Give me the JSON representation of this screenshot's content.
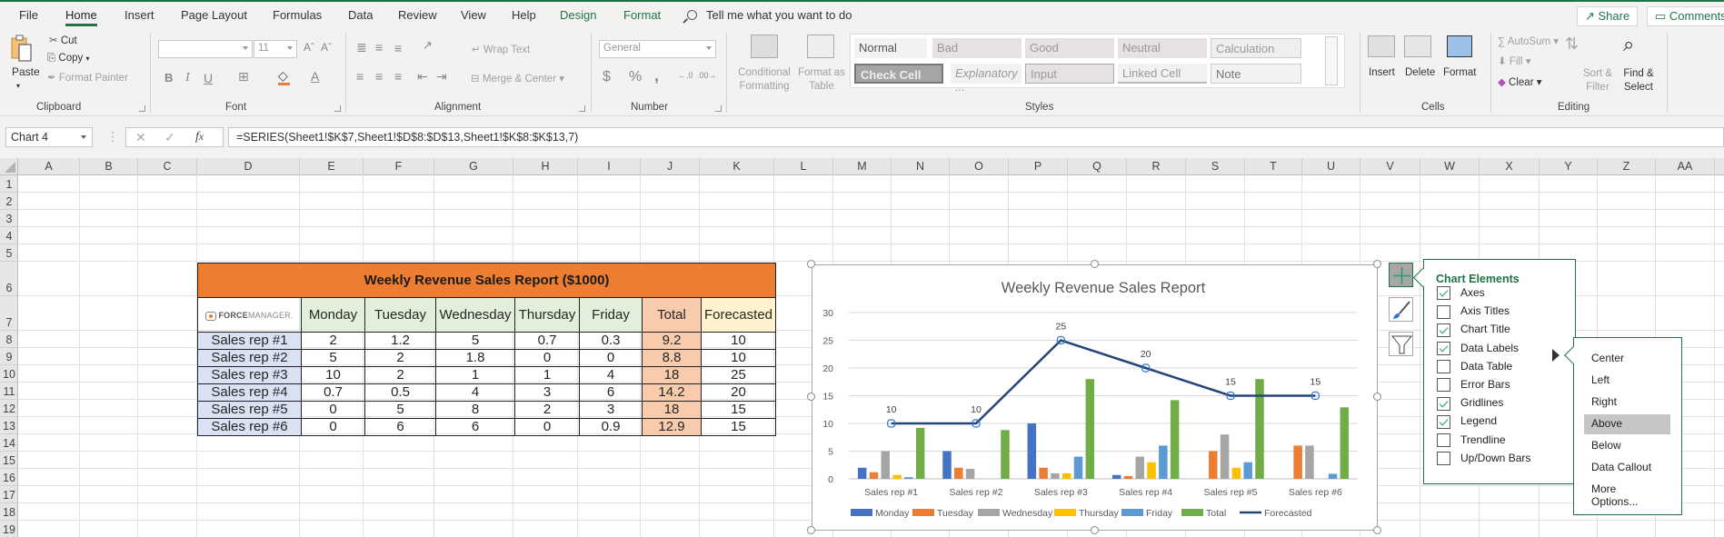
{
  "menu": {
    "tabs": [
      "File",
      "Home",
      "Insert",
      "Page Layout",
      "Formulas",
      "Data",
      "Review",
      "View",
      "Help"
    ],
    "active_tab": "Home",
    "context_tabs": [
      "Design",
      "Format"
    ],
    "tell_me": "Tell me what you want to do",
    "share": "Share",
    "comments": "Comments"
  },
  "ribbon": {
    "clipboard": {
      "paste": "Paste",
      "cut": "Cut",
      "copy": "Copy",
      "format_painter": "Format Painter",
      "label": "Clipboard"
    },
    "font": {
      "font_name": "",
      "font_size": "11",
      "bold": "B",
      "italic": "I",
      "underline": "U",
      "label": "Font"
    },
    "alignment": {
      "wrap_text": "Wrap Text",
      "merge_center": "Merge & Center",
      "label": "Alignment"
    },
    "number": {
      "format": "General",
      "currency": "$",
      "percent": "%",
      "comma": ",",
      "label": "Number"
    },
    "styles": {
      "conditional_formatting": "Conditional Formatting",
      "format_as_table": "Format as Table",
      "cells": [
        "Normal",
        "Bad",
        "Good",
        "Neutral",
        "Calculation",
        "Check Cell",
        "Explanatory ...",
        "Input",
        "Linked Cell",
        "Note"
      ],
      "label": "Styles"
    },
    "cells": {
      "insert": "Insert",
      "delete": "Delete",
      "format": "Format",
      "label": "Cells"
    },
    "editing": {
      "autosum": "AutoSum",
      "fill": "Fill",
      "clear": "Clear",
      "sort_filter": "Sort & Filter",
      "find_select": "Find & Select",
      "label": "Editing"
    }
  },
  "formula_bar": {
    "name_box": "Chart 4",
    "formula": "=SERIES(Sheet1!$K$7,Sheet1!$D$8:$D$13,Sheet1!$K$8:$K$13,7)"
  },
  "grid": {
    "columns": [
      "A",
      "B",
      "C",
      "D",
      "E",
      "F",
      "G",
      "H",
      "I",
      "J",
      "K",
      "L",
      "M",
      "N",
      "O",
      "P",
      "Q",
      "R",
      "S",
      "T",
      "U",
      "V",
      "W",
      "X",
      "Y",
      "Z",
      "AA"
    ],
    "rows": [
      "1",
      "2",
      "3",
      "4",
      "5",
      "6",
      "7",
      "8",
      "9",
      "10",
      "11",
      "12",
      "13",
      "14",
      "15",
      "16",
      "17",
      "18",
      "19"
    ]
  },
  "report_table": {
    "title": "Weekly Revenue Sales Report ($1000)",
    "logo": {
      "bold": "FORCE",
      "light": "MANAGER."
    },
    "headers": [
      "Monday",
      "Tuesday",
      "Wednesday",
      "Thursday",
      "Friday",
      "Total",
      "Forecasted"
    ],
    "rows": [
      {
        "rep": "Sales rep #1",
        "values": [
          "2",
          "1.2",
          "5",
          "0.7",
          "0.3",
          "9.2",
          "10"
        ]
      },
      {
        "rep": "Sales rep #2",
        "values": [
          "5",
          "2",
          "1.8",
          "0",
          "0",
          "8.8",
          "10"
        ]
      },
      {
        "rep": "Sales rep #3",
        "values": [
          "10",
          "2",
          "1",
          "1",
          "4",
          "18",
          "25"
        ]
      },
      {
        "rep": "Sales rep #4",
        "values": [
          "0.7",
          "0.5",
          "4",
          "3",
          "6",
          "14.2",
          "20"
        ]
      },
      {
        "rep": "Sales rep #5",
        "values": [
          "0",
          "5",
          "8",
          "2",
          "3",
          "18",
          "15"
        ]
      },
      {
        "rep": "Sales rep #6",
        "values": [
          "0",
          "6",
          "6",
          "0",
          "0.9",
          "12.9",
          "15"
        ]
      }
    ]
  },
  "chart_data": {
    "type": "bar",
    "title": "Weekly Revenue Sales Report",
    "categories": [
      "Sales rep #1",
      "Sales rep #2",
      "Sales rep #3",
      "Sales rep #4",
      "Sales rep #5",
      "Sales rep #6"
    ],
    "series": [
      {
        "name": "Monday",
        "type": "bar",
        "color": "#4472c4",
        "values": [
          2,
          5,
          10,
          0.7,
          0,
          0
        ]
      },
      {
        "name": "Tuesday",
        "type": "bar",
        "color": "#ed7d31",
        "values": [
          1.2,
          2,
          2,
          0.5,
          5,
          6
        ]
      },
      {
        "name": "Wednesday",
        "type": "bar",
        "color": "#a5a5a5",
        "values": [
          5,
          1.8,
          1,
          4,
          8,
          6
        ]
      },
      {
        "name": "Thursday",
        "type": "bar",
        "color": "#ffc000",
        "values": [
          0.7,
          0,
          1,
          3,
          2,
          0
        ]
      },
      {
        "name": "Friday",
        "type": "bar",
        "color": "#5b9bd5",
        "values": [
          0.3,
          0,
          4,
          6,
          3,
          0.9
        ]
      },
      {
        "name": "Total",
        "type": "bar",
        "color": "#70ad47",
        "values": [
          9.2,
          8.8,
          18,
          14.2,
          18,
          12.9
        ]
      },
      {
        "name": "Forecasted",
        "type": "line",
        "color": "#264478",
        "values": [
          10,
          10,
          25,
          20,
          15,
          15
        ],
        "data_labels": [
          "10",
          "10",
          "25",
          "20",
          "15",
          "15"
        ]
      }
    ],
    "ylim": [
      0,
      30
    ],
    "yticks": [
      "0",
      "5",
      "10",
      "15",
      "20",
      "25",
      "30"
    ],
    "xlabel": "",
    "ylabel": "",
    "grid": true,
    "legend": "bottom"
  },
  "chart_elements": {
    "title": "Chart Elements",
    "items": [
      {
        "label": "Axes",
        "checked": true
      },
      {
        "label": "Axis Titles",
        "checked": false
      },
      {
        "label": "Chart Title",
        "checked": true
      },
      {
        "label": "Data Labels",
        "checked": true
      },
      {
        "label": "Data Table",
        "checked": false
      },
      {
        "label": "Error Bars",
        "checked": false
      },
      {
        "label": "Gridlines",
        "checked": true
      },
      {
        "label": "Legend",
        "checked": true
      },
      {
        "label": "Trendline",
        "checked": false
      },
      {
        "label": "Up/Down Bars",
        "checked": false
      }
    ]
  },
  "data_labels_menu": {
    "items": [
      "Center",
      "Left",
      "Right",
      "Above",
      "Below",
      "Data Callout",
      "More Options..."
    ],
    "highlighted": "Above"
  }
}
